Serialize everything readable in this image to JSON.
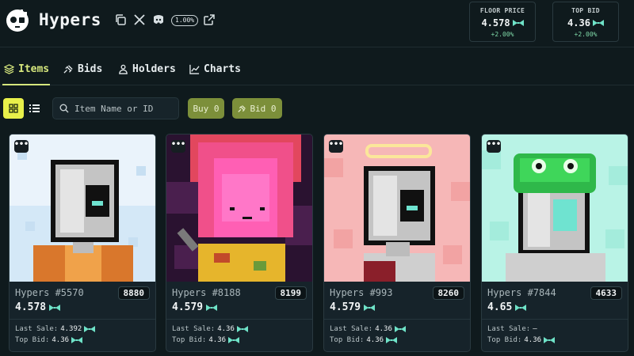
{
  "header": {
    "title": "Hypers",
    "badge": "1.00%",
    "floor": {
      "label": "FLOOR PRICE",
      "value": "4.578",
      "change": "+2.00%"
    },
    "top_bid": {
      "label": "TOP BID",
      "value": "4.36",
      "change": "+2.00%"
    }
  },
  "tabs": [
    {
      "label": "Items",
      "icon": "layers-icon",
      "active": true
    },
    {
      "label": "Bids",
      "icon": "gavel-icon",
      "active": false
    },
    {
      "label": "Holders",
      "icon": "users-icon",
      "active": false
    },
    {
      "label": "Charts",
      "icon": "chart-icon",
      "active": false
    }
  ],
  "toolbar": {
    "search_placeholder": "Item Name or ID",
    "buy_label": "Buy 0",
    "bid_label": "Bid 0"
  },
  "labels": {
    "last_sale": "Last Sale:",
    "top_bid": "Top Bid:"
  },
  "cards": [
    {
      "name": "Hypers #5570",
      "rank": "8880",
      "price": "4.578",
      "last_sale": "4.392",
      "top_bid": "4.36"
    },
    {
      "name": "Hypers #8188",
      "rank": "8199",
      "price": "4.579",
      "last_sale": "4.36",
      "top_bid": "4.36"
    },
    {
      "name": "Hypers #993",
      "rank": "8260",
      "price": "4.579",
      "last_sale": "4.36",
      "top_bid": "4.36"
    },
    {
      "name": "Hypers #7844",
      "rank": "4633",
      "price": "4.65",
      "last_sale": "–",
      "top_bid": "4.36"
    }
  ],
  "colors": {
    "accent": "#d6e77d",
    "positive": "#7fd9a8",
    "token": "#6fe3c8",
    "button": "#7c8f3a"
  }
}
